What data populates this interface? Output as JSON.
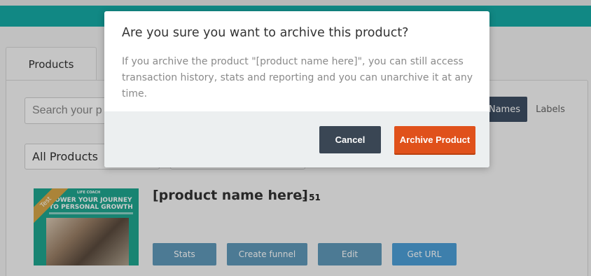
{
  "background": {
    "tab_products_label": "Products",
    "search_placeholder": "Search your p",
    "view_toggle": {
      "names_label": "Names",
      "labels_label": "Labels"
    },
    "filter_value": "All Products",
    "product": {
      "thumb_brand": "LIFE COACH",
      "thumb_headline": "POWER YOUR JOURNEY TO PERSONAL GROWTH",
      "thumb_ribbon": "Test",
      "title": "[product name here]",
      "count": "-- 51",
      "actions": {
        "stats": "Stats",
        "create_funnel": "Create funnel",
        "edit": "Edit",
        "get_url": "Get URL"
      }
    }
  },
  "modal": {
    "title": "Are you sure you want to archive this product?",
    "body": "If you archive the product \"[product name here]\", you can still access transaction history, stats and reporting and you can unarchive it at any time.",
    "cancel_label": "Cancel",
    "confirm_label": "Archive Product"
  },
  "colors": {
    "top_bar": "#16aaa6",
    "cancel_button": "#3a4654",
    "archive_button": "#e0511b",
    "names_toggle": "#3e4e63"
  }
}
